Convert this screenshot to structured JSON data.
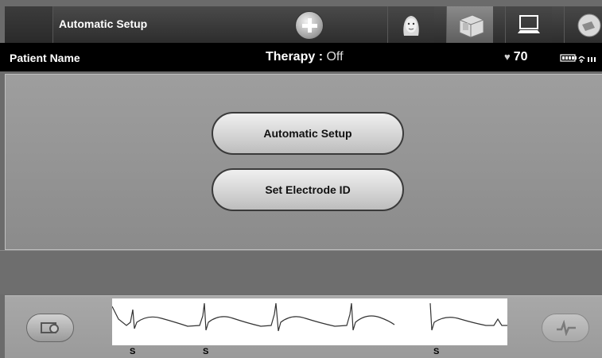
{
  "header": {
    "title": "Automatic Setup",
    "tabs": [
      {
        "icon": "patient-face-icon"
      },
      {
        "icon": "electrode-pads-icon",
        "active": true
      },
      {
        "icon": "monitor-icon"
      },
      {
        "icon": "settings-icon"
      }
    ]
  },
  "patient_bar": {
    "patient_name": "Patient Name",
    "therapy_label": "Therapy :",
    "therapy_value": "Off",
    "heart_rate": "70"
  },
  "main": {
    "automatic_setup_label": "Automatic Setup",
    "set_electrode_label": "Set Electrode ID"
  },
  "ecg": {
    "markers": [
      "S",
      "S",
      "S"
    ]
  }
}
